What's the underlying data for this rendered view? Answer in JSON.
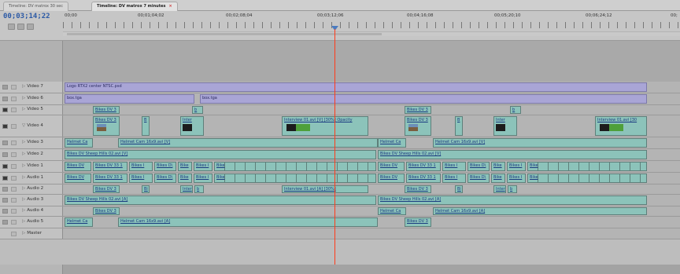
{
  "tabs": [
    {
      "label": "Timeline: DV matrox 30 sec",
      "active": false
    },
    {
      "label": "Timeline: DV matrox 7 minutes",
      "active": true
    }
  ],
  "timecode": "00;03;14;22",
  "ruler_labels": [
    "00;00",
    "00;01;04;02",
    "00;02;08;04",
    "00;03;12;06",
    "00;04;16;08",
    "00;05;20;10",
    "00;06;24;12",
    "00;"
  ],
  "colors": {
    "playhead": "#ff3a1a",
    "video_clip": "#8cc3ba",
    "graphic_clip": "#a9a5d6",
    "timecode": "#2c5aa6"
  },
  "tracks": [
    {
      "name": "Video 7",
      "clips": [
        "Logo RTX2 center NTSC.psd"
      ]
    },
    {
      "name": "Video 6",
      "clips": [
        "box.tga",
        "box.tga"
      ]
    },
    {
      "name": "Video 5",
      "clips": [
        "Bikes DV 3",
        "b",
        "Bikes DV 3",
        "b"
      ]
    },
    {
      "name": "Video 4",
      "clips": [
        "Bikes DV 3",
        "B",
        "Inter",
        "Interview 01.avi [V] [30%]",
        "Opacity",
        "Bikes DV 3",
        "B",
        "Inter",
        "Interview 01.avi [30"
      ]
    },
    {
      "name": "Video 3",
      "clips": [
        "Helmet Ca",
        "Helmet Cam 16x9.avi [V]",
        "Helmet Ca",
        "Helmet Cam 16x9.avi [V]"
      ]
    },
    {
      "name": "Video 2",
      "clips": [
        "Bikes DV Sheep Hills 02.avi [V]",
        "Bikes DV Sheep Hills 02.avi [V]"
      ]
    },
    {
      "name": "Video 1",
      "clips": [
        "Bikes DV",
        "Bikes DV 33 1",
        "Bikes I",
        "Bikes D\\",
        "Bike",
        "Bikes I",
        "Bike",
        "Bikes DV",
        "Bikes DV 33 1",
        "Bikes I",
        "Bikes D\\",
        "Bike",
        "Bikes I",
        "Bike"
      ]
    },
    {
      "name": "Audio 1",
      "clips": [
        "Bikes DV",
        "Bikes DV 33 1",
        "Bikes I",
        "Bikes D\\",
        "Bike",
        "Bikes I",
        "Bike",
        "Bikes DV",
        "Bikes DV 33 1",
        "Bikes I",
        "Bikes D\\",
        "Bike",
        "Bikes I",
        "Bike"
      ]
    },
    {
      "name": "Audio 2",
      "clips": [
        "Bikes DV 3",
        "Bi",
        "Inter",
        "b",
        "Interview 01.avi [A] [30%]",
        "Bikes DV 3",
        "Bi",
        "Inter",
        "b"
      ]
    },
    {
      "name": "Audio 3",
      "clips": [
        "Bikes DV Sheep Hills 02.avi [A]",
        "Bikes DV Sheep Hills 02.avi [A]"
      ]
    },
    {
      "name": "Audio 4",
      "clips": [
        "Bikes DV 3",
        "Helmet Ca",
        "Helmet Cam 16x9.avi [A]"
      ]
    },
    {
      "name": "Audio 5",
      "clips": [
        "Helmet Ca",
        "Helmet Cam 16x9.avi [A]",
        "Bikes DV 3"
      ]
    },
    {
      "name": "Master",
      "clips": []
    }
  ]
}
